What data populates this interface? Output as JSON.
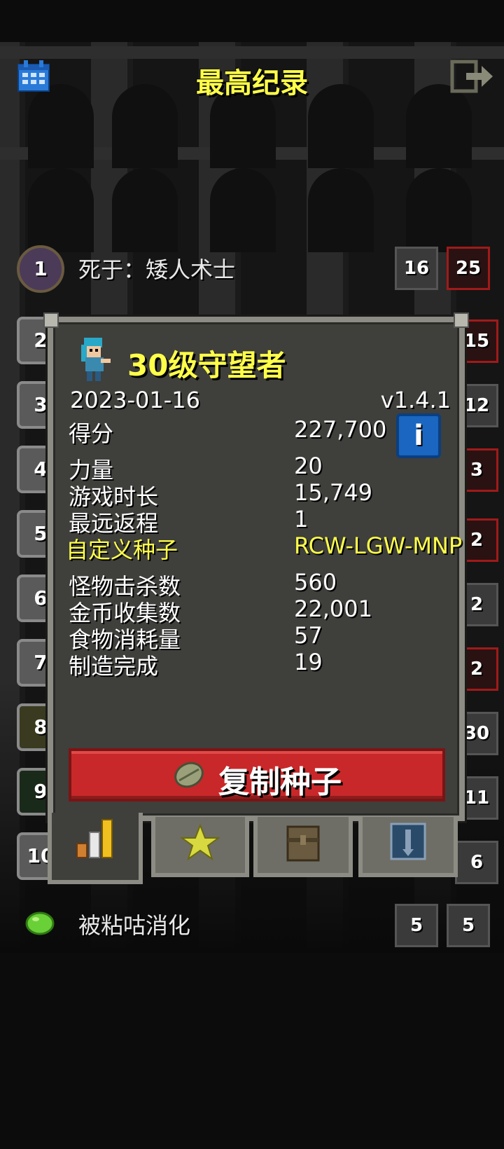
{
  "header": {
    "title": "最高纪录",
    "calendar_icon": "calendar-icon",
    "exit_icon": "exit-icon"
  },
  "ranks": {
    "first": {
      "rank": "1",
      "cause": "死于：矮人术士",
      "depth": "16",
      "level": "25"
    },
    "behind": [
      "2",
      "3",
      "4",
      "5",
      "6",
      "7",
      "8",
      "9",
      "10"
    ],
    "behind_levels": [
      "15",
      "12",
      "3",
      "2",
      "2",
      "2",
      "30",
      "11",
      "6"
    ],
    "last": {
      "cause": "被粘咕消化",
      "depth": "5",
      "level": "5"
    }
  },
  "dialog": {
    "hero_title": "30级守望者",
    "date": "2023-01-16",
    "version": "v1.4.1",
    "info_label": "i",
    "stats": [
      {
        "label": "得分",
        "value": "227,700"
      },
      {
        "label": "力量",
        "value": "20"
      },
      {
        "label": "游戏时长",
        "value": "15,749"
      },
      {
        "label": "最远返程",
        "value": "1"
      },
      {
        "label": "自定义种子",
        "value": "RCW-LGW-MNP",
        "highlight": true
      },
      {
        "label": "怪物击杀数",
        "value": "560"
      },
      {
        "label": "金币收集数",
        "value": "22,001"
      },
      {
        "label": "食物消耗量",
        "value": "57"
      },
      {
        "label": "制造完成",
        "value": "19"
      }
    ],
    "copy_seed_label": "复制种子"
  },
  "tabs": [
    {
      "icon": "stats-bars-icon",
      "active": true
    },
    {
      "icon": "badge-star-icon",
      "active": false
    },
    {
      "icon": "backpack-icon",
      "active": false
    },
    {
      "icon": "challenges-icon",
      "active": false
    }
  ],
  "colors": {
    "accent": "#ffff4a",
    "button_red": "#c8282a",
    "info_blue": "#1a66c0",
    "panel": "#3f3f3c"
  }
}
